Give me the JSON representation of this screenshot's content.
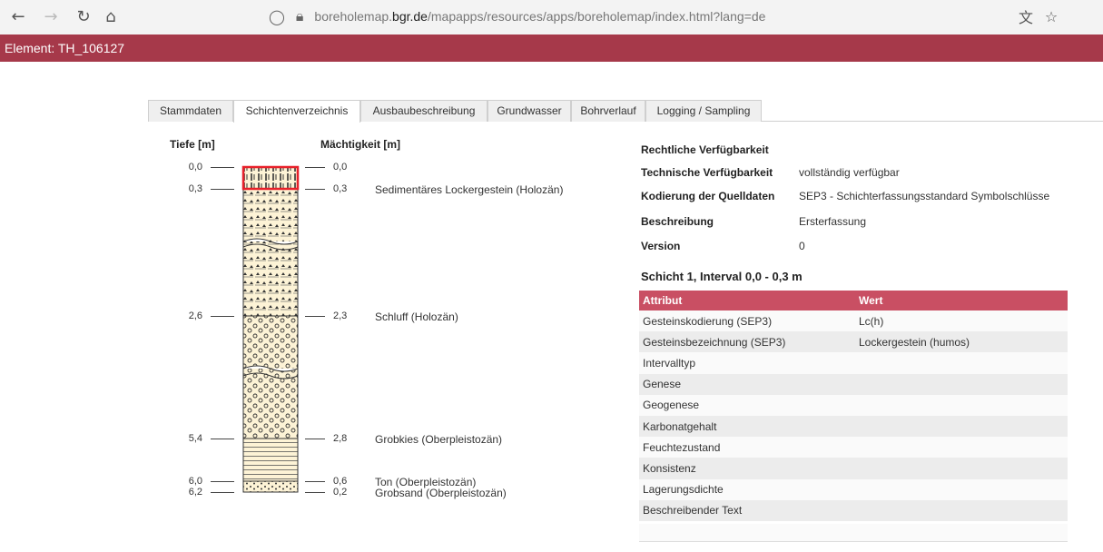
{
  "browser": {
    "url_prefix": "borehole",
    "url_middle": "map.",
    "url_domain": "bgr.de",
    "url_suffix": "/mapapps/resources/apps/boreholemap/index.html?lang=de"
  },
  "header": {
    "title": "Element: TH_106127",
    "color": "#a6394a"
  },
  "tabs": [
    {
      "label": "Stammdaten",
      "active": false
    },
    {
      "label": "Schichtenverzeichnis",
      "active": true
    },
    {
      "label": "Ausbaubeschreibung",
      "active": false
    },
    {
      "label": "Grundwasser",
      "active": false
    },
    {
      "label": "Bohrverlauf",
      "active": false
    },
    {
      "label": "Logging / Sampling",
      "active": false
    }
  ],
  "profile": {
    "depth_header": "Tiefe [m]",
    "thickness_header": "Mächtigkeit [m]",
    "top_depth": "0,0",
    "top_thickness": "0,0",
    "layers": [
      {
        "depth": "0,3",
        "thickness": "0,3",
        "description": "Sedimentäres Lockergestein (Holozän)"
      },
      {
        "depth": "2,6",
        "thickness": "2,3",
        "description": "Schluff (Holozän)"
      },
      {
        "depth": "5,4",
        "thickness": "2,8",
        "description": "Grobkies (Oberpleistozän)"
      },
      {
        "depth": "6,0",
        "thickness": "0,6",
        "description": "Ton (Oberpleistozän)"
      },
      {
        "depth": "6,2",
        "thickness": "0,2",
        "description": "Grobsand (Oberpleistozän)"
      }
    ]
  },
  "info": [
    {
      "label": "Rechtliche Verfügbarkeit",
      "value": ""
    },
    {
      "label": "Technische Verfügbarkeit",
      "value": "vollständig verfügbar"
    },
    {
      "label": "Kodierung der Quelldaten",
      "value": "SEP3 - Schichterfassungsstandard Symbolschlüsse"
    },
    {
      "label": "Beschreibung",
      "value": "Ersterfassung"
    },
    {
      "label": "Version",
      "value": "0"
    }
  ],
  "layer_detail": {
    "title": "Schicht 1, Interval 0,0 - 0,3 m",
    "col_attribute": "Attribut",
    "col_value": "Wert",
    "rows": [
      {
        "attr": "Gesteinskodierung (SEP3)",
        "value": "Lc(h)"
      },
      {
        "attr": "Gesteinsbezeichnung (SEP3)",
        "value": "Lockergestein (humos)"
      },
      {
        "attr": "Intervalltyp",
        "value": ""
      },
      {
        "attr": "Genese",
        "value": ""
      },
      {
        "attr": "Geogenese",
        "value": ""
      },
      {
        "attr": "Karbonatgehalt",
        "value": ""
      },
      {
        "attr": "Feuchtezustand",
        "value": ""
      },
      {
        "attr": "Konsistenz",
        "value": ""
      },
      {
        "attr": "Lagerungsdichte",
        "value": ""
      },
      {
        "attr": "Beschreibender Text",
        "value": ""
      }
    ]
  },
  "colors": {
    "accent": "#a6394a",
    "table_header": "#c94f63",
    "highlight": "#e8202a",
    "layer_fill": "#fdf3d6"
  },
  "icons": [
    "back-arrow-icon",
    "forward-arrow-icon",
    "reload-icon",
    "home-icon",
    "shield-icon",
    "lock-icon",
    "translate-icon",
    "star-icon"
  ]
}
